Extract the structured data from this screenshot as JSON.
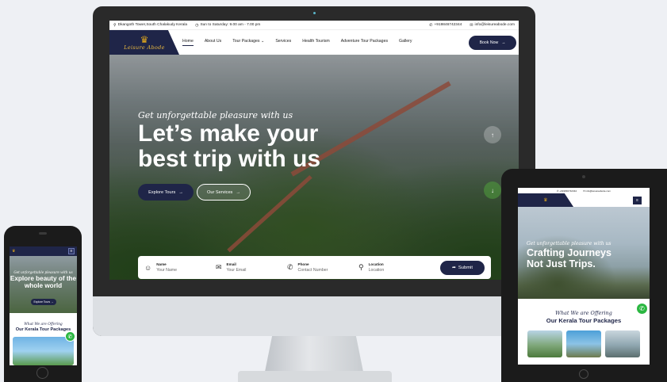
{
  "desktop": {
    "topbar": {
      "address": "Dkangoth Tower,South Chalakudy Kerala",
      "hours": "Sun to Saturday: 9.00 am - 7.00 pm",
      "phone": "+919846742344",
      "email": "info@leisureabode.com"
    },
    "logo_text": "Leisure Abode",
    "menu": [
      "Home",
      "About Us",
      "Tour Packages",
      "Services",
      "Health Tourism",
      "Adventure Tour Packages",
      "Gallery"
    ],
    "book_now": "Book Now",
    "hero": {
      "script": "Get unforgettable pleasure with us",
      "headline": "Let’s make your best trip with us",
      "explore": "Explore Tours",
      "services": "Our Services"
    },
    "form": {
      "fields": [
        {
          "label": "Name",
          "placeholder": "Your Name"
        },
        {
          "label": "Email",
          "placeholder": "Your Email"
        },
        {
          "label": "Phone",
          "placeholder": "Contact Number"
        },
        {
          "label": "Location",
          "placeholder": "Location"
        }
      ],
      "submit": "Submit"
    }
  },
  "phone": {
    "logo_text": "Leisure Abode",
    "script": "Get unforgettable pleasure with us",
    "headline": "Explore beauty of the whole world",
    "button": "Explore Tours",
    "sub": "What We are Offering",
    "title": "Our Kerala Tour Packages"
  },
  "tablet": {
    "phone": "+919846742344",
    "email": "info@leisureabode.com",
    "logo_text": "Leisure Abode",
    "script": "Get unforgettable pleasure with us",
    "headline": "Crafting Journeys Not Just Trips.",
    "sub": "What We are Offering",
    "title": "Our Kerala Tour Packages"
  },
  "colors": {
    "navy": "#1f2548",
    "gold": "#e0a71c",
    "whatsapp": "#2bb741"
  }
}
